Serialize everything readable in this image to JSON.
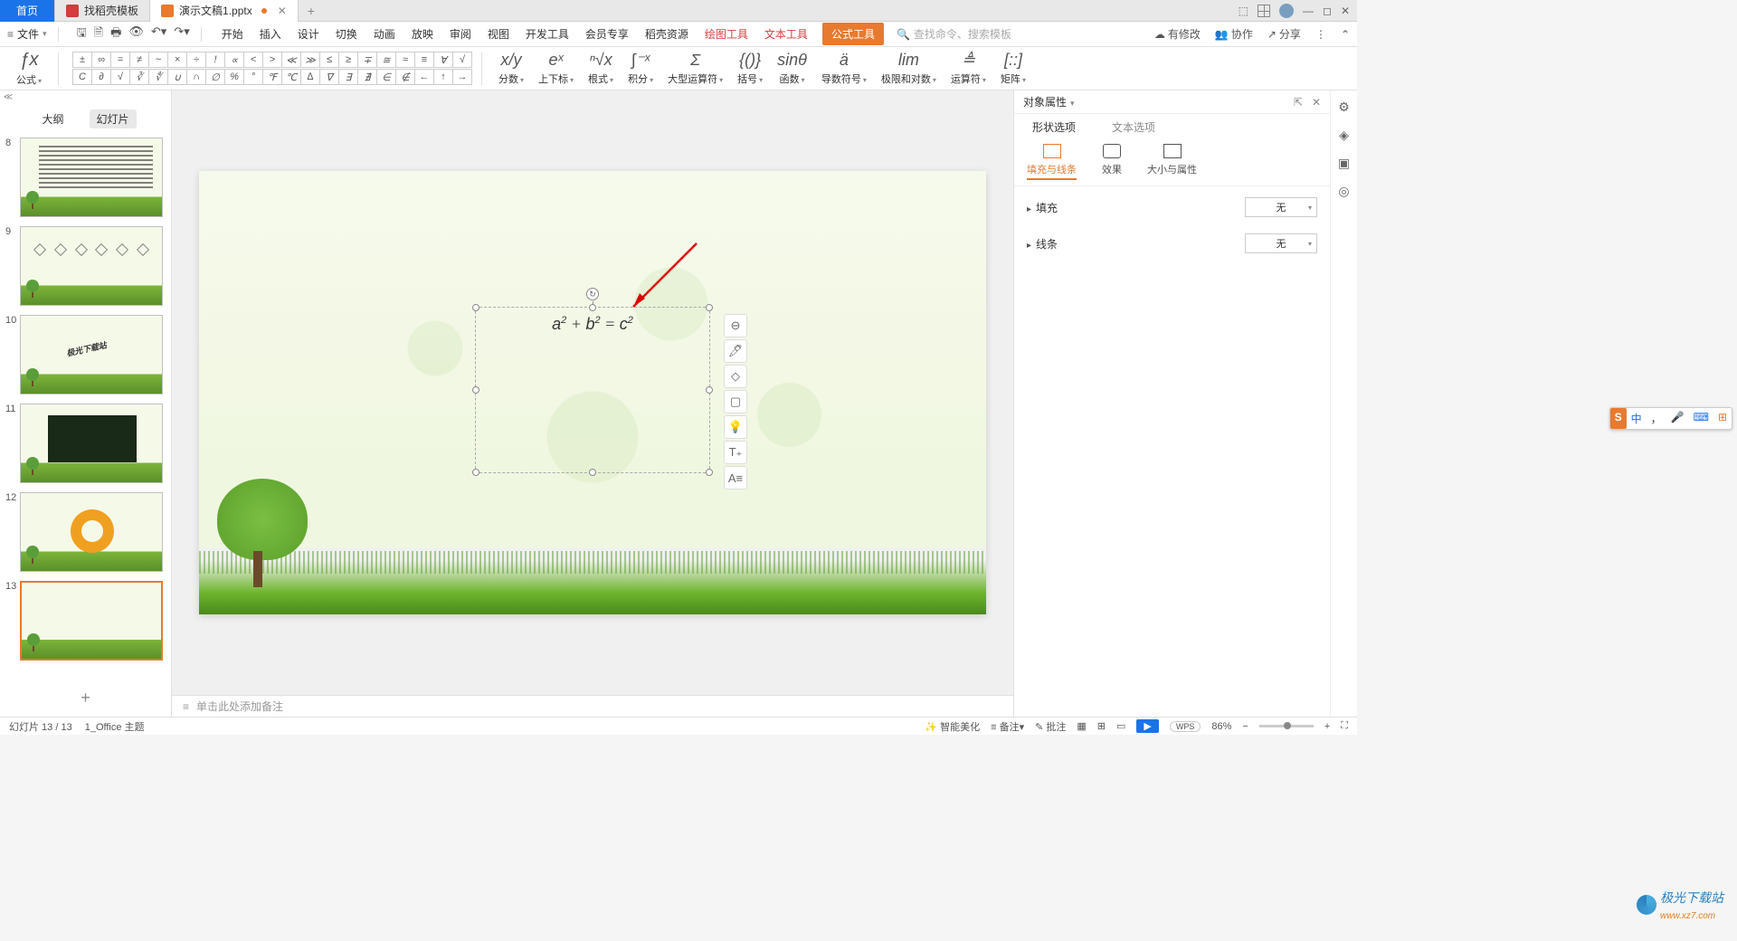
{
  "tabs": {
    "home": "首页",
    "t1": "找稻壳模板",
    "t2": "演示文稿1.pptx"
  },
  "menu": {
    "file": "文件",
    "items": [
      "开始",
      "插入",
      "设计",
      "切换",
      "动画",
      "放映",
      "审阅",
      "视图",
      "开发工具",
      "会员专享",
      "稻壳资源"
    ],
    "tools": [
      "绘图工具",
      "文本工具",
      "公式工具"
    ],
    "search_ph": "查找命令、搜索模板",
    "right": {
      "modify": "有修改",
      "coop": "协作",
      "share": "分享"
    }
  },
  "ribbon": {
    "formula": "公式",
    "row1": [
      "±",
      "∞",
      "=",
      "≠",
      "~",
      "×",
      "÷",
      "!",
      "∝",
      "<",
      ">",
      "≪",
      "≫",
      "≤",
      "≥",
      "∓",
      "≅",
      "≈",
      "≡",
      "∀",
      "√"
    ],
    "row2": [
      "C",
      "∂",
      "√",
      "∛",
      "∜",
      "∪",
      "∩",
      "∅",
      "%",
      "°",
      "℉",
      "℃",
      "∆",
      "∇",
      "∃",
      "∄",
      "∈",
      "∉",
      "←",
      "↑",
      "→"
    ],
    "groups": {
      "frac": "分数",
      "sub": "上下标",
      "root": "根式",
      "integral": "积分",
      "bigop": "大型运算符",
      "bracket": "括号",
      "func": "函数",
      "deriv": "导数符号",
      "limit": "极限和对数",
      "operator": "运算符",
      "matrix": "矩阵"
    },
    "icons": {
      "frac": "x/y",
      "sub": "eˣ",
      "root": "ⁿ√x",
      "integral": "∫⁻ˣ",
      "bigop": "Σ",
      "bracket": "{()}",
      "func": "sinθ",
      "deriv": "ä",
      "limit": "lim",
      "operator": "≜",
      "matrix": "[::]"
    }
  },
  "left": {
    "tab_outline": "大纲",
    "tab_slides": "幻灯片",
    "slides": [
      8,
      9,
      10,
      11,
      12,
      13
    ]
  },
  "canvas": {
    "formula": "a² + b² = c²",
    "notes_ph": "单击此处添加备注"
  },
  "right_panel": {
    "title": "对象属性",
    "tab_shape": "形状选项",
    "tab_text": "文本选项",
    "sub1": "填充与线条",
    "sub2": "效果",
    "sub3": "大小与属性",
    "fill": "填充",
    "line": "线条",
    "none": "无"
  },
  "status": {
    "slide": "幻灯片 13 / 13",
    "theme": "1_Office 主题",
    "beautify": "智能美化",
    "notes": "备注",
    "批注": "批注",
    "zoom": "86%",
    "wps": "WPS"
  },
  "ime": {
    "zh": "中",
    "comma": "，"
  },
  "watermark": {
    "name": "极光下载站",
    "sub": "www.xz7.com"
  }
}
